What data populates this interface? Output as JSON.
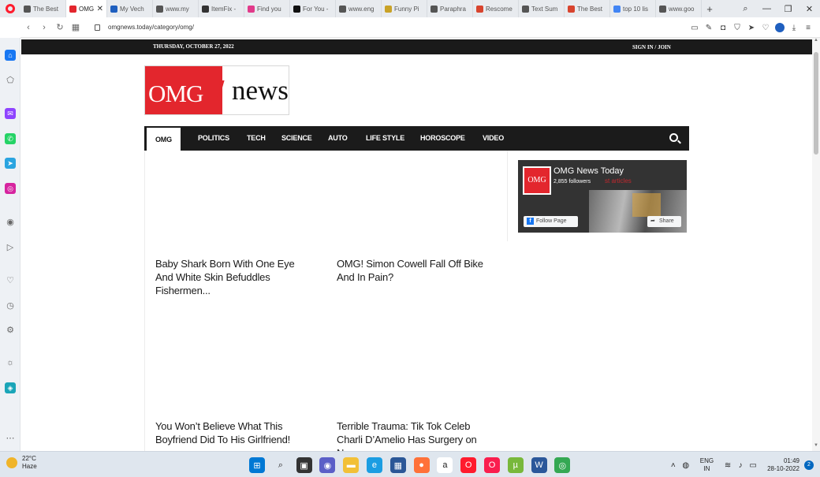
{
  "browser": {
    "tabs": [
      {
        "label": "The Best",
        "fav_color": "#555555"
      },
      {
        "label": "OMG",
        "fav_color": "#e3262d",
        "active": true
      },
      {
        "label": "My Vech",
        "fav_color": "#1f5fbf"
      },
      {
        "label": "www.my",
        "fav_color": "#555555"
      },
      {
        "label": "ItemFix -",
        "fav_color": "#333333"
      },
      {
        "label": "Find you",
        "fav_color": "#e13b8a"
      },
      {
        "label": "For You -",
        "fav_color": "#111111"
      },
      {
        "label": "www.eng",
        "fav_color": "#555555"
      },
      {
        "label": "Funny Pi",
        "fav_color": "#c9a227"
      },
      {
        "label": "Paraphra",
        "fav_color": "#555555"
      },
      {
        "label": "Rescome",
        "fav_color": "#d8442e"
      },
      {
        "label": "Text Sum",
        "fav_color": "#555555"
      },
      {
        "label": "The Best",
        "fav_color": "#d8442e"
      },
      {
        "label": "top 10 lis",
        "fav_color": "#4285f4"
      },
      {
        "label": "www.goo",
        "fav_color": "#555555"
      }
    ],
    "new_tab_label": "+",
    "url": "omgnews.today/category/omg/"
  },
  "site": {
    "date": "THURSDAY, OCTOBER 27, 2022",
    "signin": "SIGN IN / JOIN",
    "logo": {
      "omg": "OMG",
      "bang": "!",
      "news": "news"
    },
    "nav": [
      {
        "label": "OMG",
        "active": true
      },
      {
        "label": "POLITICS"
      },
      {
        "label": "TECH"
      },
      {
        "label": "SCIENCE"
      },
      {
        "label": "AUTO"
      },
      {
        "label": "LIFE STYLE"
      },
      {
        "label": "HOROSCOPE"
      },
      {
        "label": "VIDEO"
      }
    ],
    "fb_widget": {
      "logo_text": "OMG",
      "title": "OMG News Today",
      "followers": "2,855 followers",
      "ghost_text": "st articles",
      "follow_label": "Follow Page",
      "share_label": "Share"
    },
    "articles": [
      {
        "title": "Baby Shark Born With One Eye And White Skin Befuddles Fishermen..."
      },
      {
        "title": "OMG! Simon Cowell Fall Off Bike And In Pain?"
      },
      {
        "title": "You Won’t Believe What This Boyfriend Did To His Girlfriend!"
      },
      {
        "title": "Terrible Trauma: Tik Tok Celeb Charli D’Amelio Has Surgery on N..."
      }
    ]
  },
  "taskbar": {
    "temperature": "22°C",
    "weather": "Haze",
    "lang_top": "ENG",
    "lang_bottom": "IN",
    "time": "01:49",
    "date": "28-10-2022",
    "notifications": "2",
    "apps": [
      {
        "name": "start",
        "color": "#0078d4",
        "glyph": "⊞"
      },
      {
        "name": "search",
        "color": "#dfe6ee",
        "glyph": "⌕"
      },
      {
        "name": "task-view",
        "color": "#333333",
        "glyph": "▣"
      },
      {
        "name": "chat",
        "color": "#5b5fc7",
        "glyph": "◉"
      },
      {
        "name": "file-explorer",
        "color": "#f2c037",
        "glyph": "▬"
      },
      {
        "name": "edge",
        "color": "#1b9de2",
        "glyph": "e"
      },
      {
        "name": "store",
        "color": "#2b5797",
        "glyph": "▦"
      },
      {
        "name": "firefox",
        "color": "#ff7139",
        "glyph": "●"
      },
      {
        "name": "amazon",
        "color": "#ffffff",
        "glyph": "a"
      },
      {
        "name": "opera",
        "color": "#ff1b2d",
        "glyph": "O"
      },
      {
        "name": "opera-gx",
        "color": "#fa1e4e",
        "glyph": "O"
      },
      {
        "name": "utorrent",
        "color": "#78b83b",
        "glyph": "µ"
      },
      {
        "name": "word",
        "color": "#2b579a",
        "glyph": "W"
      },
      {
        "name": "chrome",
        "color": "#34a853",
        "glyph": "◎"
      }
    ]
  }
}
